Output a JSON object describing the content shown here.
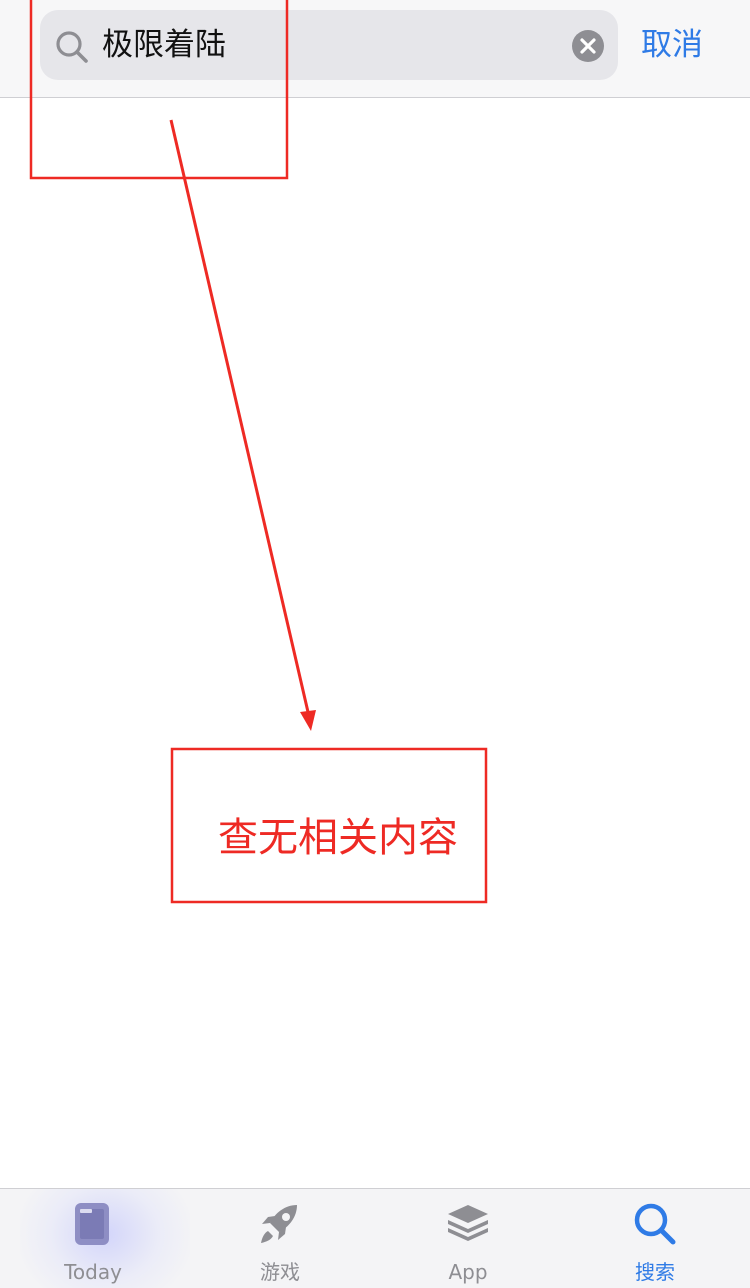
{
  "search": {
    "query": "极限着陆",
    "cancel_label": "取消"
  },
  "annotation": {
    "label": "查无相关内容",
    "color": "#ee2a24"
  },
  "tabs": [
    {
      "label": "Today",
      "icon": "today-icon",
      "active": false
    },
    {
      "label": "游戏",
      "icon": "rocket-icon",
      "active": false
    },
    {
      "label": "App",
      "icon": "layers-icon",
      "active": false
    },
    {
      "label": "搜索",
      "icon": "search-icon",
      "active": true
    }
  ],
  "colors": {
    "accent": "#2f7be6",
    "inactive_tab": "#8e8e93"
  }
}
